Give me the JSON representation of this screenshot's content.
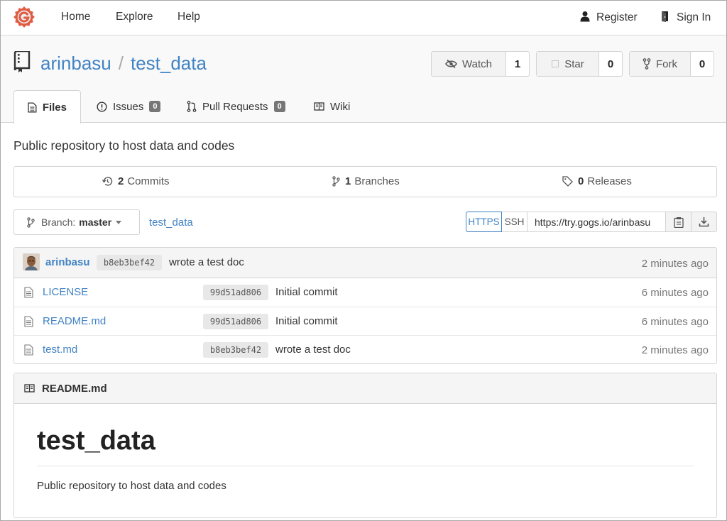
{
  "nav": {
    "home": "Home",
    "explore": "Explore",
    "help": "Help",
    "register": "Register",
    "sign_in": "Sign In"
  },
  "repo": {
    "owner": "arinbasu",
    "separator": "/",
    "name": "test_data",
    "watch_label": "Watch",
    "watch_count": "1",
    "star_label": "Star",
    "star_count": "0",
    "fork_label": "Fork",
    "fork_count": "0",
    "description": "Public repository to host data and codes"
  },
  "tabs": [
    {
      "label": "Files"
    },
    {
      "label": "Issues",
      "badge": "0"
    },
    {
      "label": "Pull Requests",
      "badge": "0"
    },
    {
      "label": "Wiki"
    }
  ],
  "stats": {
    "commits_count": "2",
    "commits_label": "Commits",
    "branches_count": "1",
    "branches_label": "Branches",
    "releases_count": "0",
    "releases_label": "Releases"
  },
  "branch": {
    "prefix": "Branch:",
    "name": "master",
    "breadcrumb": "test_data"
  },
  "clone": {
    "https_label": "HTTPS",
    "ssh_label": "SSH",
    "url": "https://try.gogs.io/arinbasu"
  },
  "latest_commit": {
    "author": "arinbasu",
    "sha": "b8eb3bef42",
    "message": "wrote a test doc",
    "age": "2 minutes ago"
  },
  "files": [
    {
      "name": "LICENSE",
      "sha": "99d51ad806",
      "message": "Initial commit",
      "age": "6 minutes ago"
    },
    {
      "name": "README.md",
      "sha": "99d51ad806",
      "message": "Initial commit",
      "age": "6 minutes ago"
    },
    {
      "name": "test.md",
      "sha": "b8eb3bef42",
      "message": "wrote a test doc",
      "age": "2 minutes ago"
    }
  ],
  "readme": {
    "filename": "README.md",
    "heading": "test_data",
    "body": "Public repository to host data and codes"
  },
  "colors": {
    "link": "#4183c4",
    "logo": "#e05d44"
  }
}
